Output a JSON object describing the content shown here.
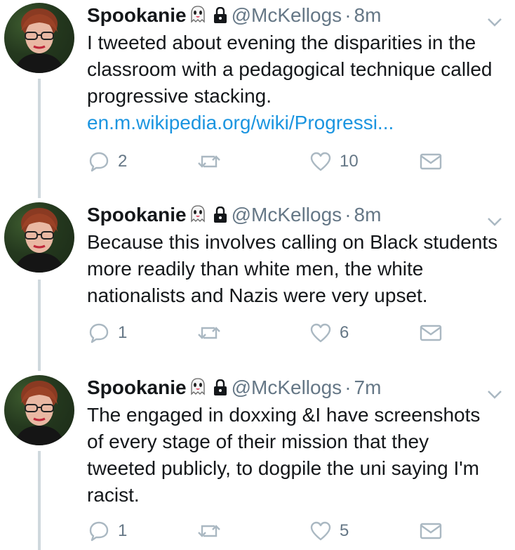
{
  "tweets": [
    {
      "name": "Spookanie",
      "handle": "@McKellogs",
      "separator": "·",
      "time": "8m",
      "text": "I tweeted about evening the disparities in the classroom with a pedagogical technique called progressive stacking.",
      "link": "en.m.wikipedia.org/wiki/Progressi...",
      "replies": "2",
      "retweets": "",
      "likes": "10"
    },
    {
      "name": "Spookanie",
      "handle": "@McKellogs",
      "separator": "·",
      "time": "8m",
      "text": "Because this involves calling on Black students more readily than white men, the white nationalists and Nazis were very upset.",
      "link": "",
      "replies": "1",
      "retweets": "",
      "likes": "6"
    },
    {
      "name": "Spookanie",
      "handle": "@McKellogs",
      "separator": "·",
      "time": "7m",
      "text": "The engaged in doxxing &I have screenshots of every stage of their mission that they tweeted publicly, to dogpile the uni saying I'm racist.",
      "link": "",
      "replies": "1",
      "retweets": "",
      "likes": "5"
    }
  ],
  "icons": {
    "ghost": "ghost-emoji-icon",
    "lock": "lock-icon",
    "menu": "chevron-down-icon",
    "reply": "reply-icon",
    "retweet": "retweet-icon",
    "like": "heart-icon",
    "dm": "envelope-icon"
  },
  "colors": {
    "link": "#1b95e0",
    "secondary_text": "#657786",
    "thread_line": "#cfd8dd",
    "icon_stroke": "#aab8c2"
  }
}
